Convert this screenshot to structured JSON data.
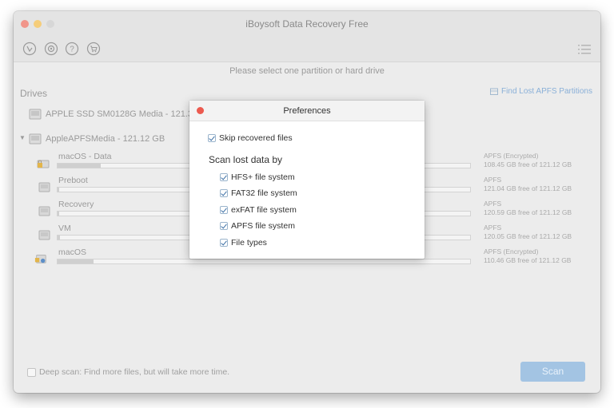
{
  "window": {
    "title": "iBoysoft Data Recovery Free"
  },
  "toolbar": {
    "icons": [
      "recover-icon",
      "settings-icon",
      "help-icon",
      "cart-icon"
    ],
    "menu_icon": "list-menu-icon"
  },
  "prompt": "Please select one partition or hard drive",
  "drives": {
    "header": "Drives",
    "apfs_link": "Find Lost APFS Partitions",
    "disks": [
      {
        "name": "APPLE SSD SM0128G Media - 121.33"
      },
      {
        "name": "AppleAPFSMedia - 121.12 GB"
      }
    ],
    "partitions": [
      {
        "name": "macOS - Data",
        "fs": "APFS (Encrypted)",
        "free": "108.45 GB free of 121.12 GB",
        "used_fraction": 0.105,
        "locked": true
      },
      {
        "name": "Preboot",
        "fs": "APFS",
        "free": "121.04 GB free of 121.12 GB",
        "used_fraction": 0.002,
        "locked": false
      },
      {
        "name": "Recovery",
        "fs": "APFS",
        "free": "120.59 GB free of 121.12 GB",
        "used_fraction": 0.003,
        "locked": false
      },
      {
        "name": "VM",
        "fs": "APFS",
        "free": "120.05 GB free of 121.12 GB",
        "used_fraction": 0.005,
        "locked": false
      },
      {
        "name": "macOS",
        "fs": "APFS (Encrypted)",
        "free": "110.46 GB free of 121.12 GB",
        "used_fraction": 0.088,
        "locked": true
      }
    ]
  },
  "deep_scan": {
    "label": "Deep scan: Find more files, but will take more time.",
    "checked": false
  },
  "scan_button": "Scan",
  "preferences": {
    "title": "Preferences",
    "skip_recovered": "Skip recovered files",
    "scan_by_label": "Scan lost data by",
    "options": [
      "HFS+ file system",
      "FAT32 file system",
      "exFAT file system",
      "APFS file system",
      "File types"
    ]
  },
  "colors": {
    "accent": "#a3c4e3",
    "close_red": "#ec5a4f",
    "link": "#8ab0d8"
  }
}
